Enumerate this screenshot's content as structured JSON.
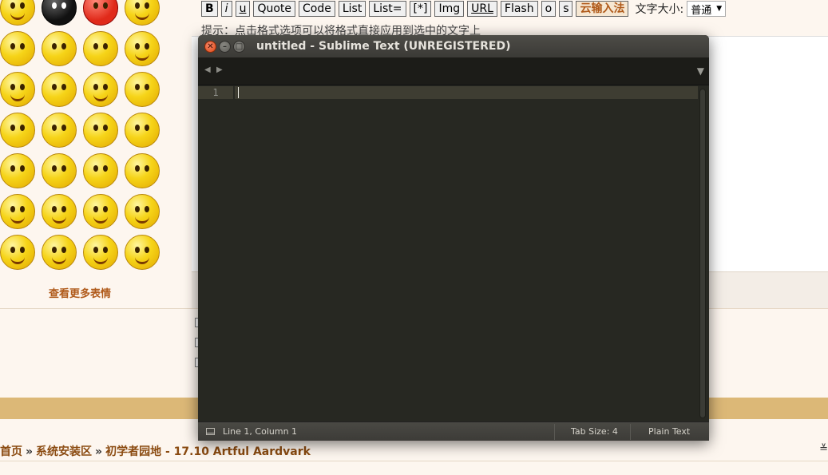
{
  "forum": {
    "more_faces": "查看更多表情",
    "toolbar": {
      "bold": "B",
      "italic": "i",
      "underline": "u",
      "quote": "Quote",
      "code": "Code",
      "list": "List",
      "list_eq": "List=",
      "list_item": "[*]",
      "img": "Img",
      "url": "URL",
      "flash": "Flash",
      "o": "o",
      "s": "s",
      "cloud_input": "云输入法",
      "font_size_label": "文字大小:",
      "font_size_value": "普通"
    },
    "hint": "提示：点击格式选项可以将格式直接应用到选中的文字上",
    "breadcrumb": {
      "home": "首页",
      "sep": "»",
      "section": "系统安装区",
      "topic": "初学者园地 - 17.10 Artful Aardvark"
    },
    "right_edge_glyph": "≚"
  },
  "sublime": {
    "title": "untitled - Sublime Text (UNREGISTERED)",
    "line_number": "1",
    "status": {
      "position": "Line 1, Column 1",
      "tab_size": "Tab Size: 4",
      "syntax": "Plain Text"
    },
    "icons": {
      "close": "close-icon",
      "minimize": "minimize-icon",
      "maximize": "maximize-icon",
      "tab_left": "arrow-left-icon",
      "tab_right": "arrow-right-icon",
      "tab_menu": "chevron-down-icon",
      "panel": "panel-toggle-icon"
    }
  },
  "colors": {
    "editor_bg": "#272822",
    "title_bg": "#3b3a36",
    "forum_link": "#8a4a10",
    "tan_bar": "#dcb877"
  }
}
